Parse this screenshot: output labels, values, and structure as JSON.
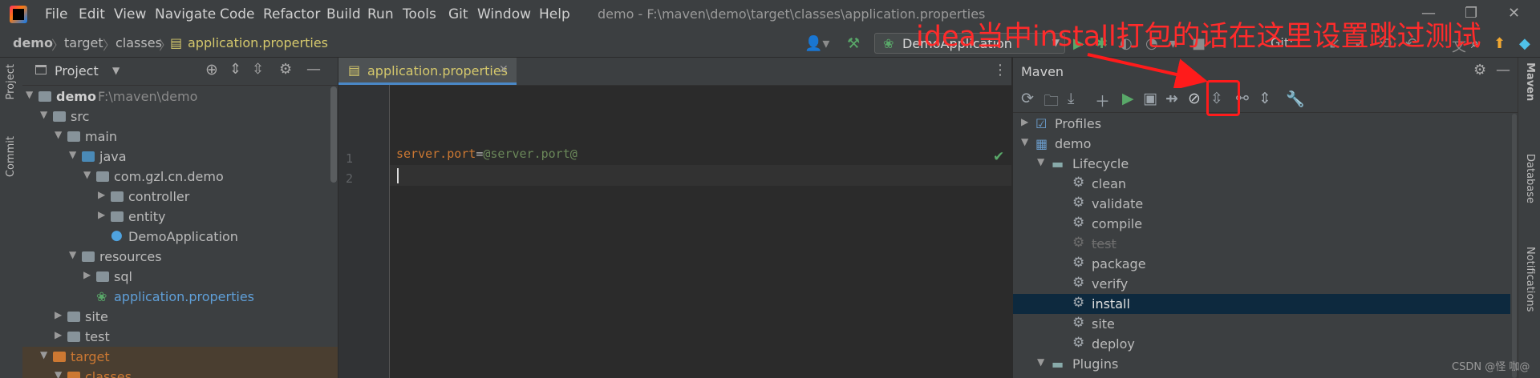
{
  "app": {
    "window_title": "demo - F:\\maven\\demo\\target\\classes\\application.properties",
    "menu": [
      "File",
      "Edit",
      "View",
      "Navigate",
      "Code",
      "Refactor",
      "Build",
      "Run",
      "Tools",
      "Git",
      "Window",
      "Help"
    ]
  },
  "breadcrumbs": [
    "demo",
    "target",
    "classes",
    "application.properties"
  ],
  "toolbar": {
    "run_config": "DemoApplication",
    "git_label": "Git:"
  },
  "left_strip": {
    "project": "Project",
    "commit": "Commit"
  },
  "right_strip": {
    "maven": "Maven",
    "database": "Database",
    "notifications": "Notifications"
  },
  "project_panel": {
    "title": "Project",
    "tree": [
      {
        "label": "demo",
        "path": "F:\\maven\\demo"
      },
      {
        "label": "src"
      },
      {
        "label": "main"
      },
      {
        "label": "java"
      },
      {
        "label": "com.gzl.cn.demo"
      },
      {
        "label": "controller"
      },
      {
        "label": "entity"
      },
      {
        "label": "DemoApplication"
      },
      {
        "label": "resources"
      },
      {
        "label": "sql"
      },
      {
        "label": "application.properties"
      },
      {
        "label": "site"
      },
      {
        "label": "test"
      },
      {
        "label": "target"
      },
      {
        "label": "classes"
      }
    ]
  },
  "editor": {
    "tab_label": "application.properties",
    "lines": [
      {
        "no": "1",
        "key": "server.port",
        "eq": "=",
        "value": "@server.port@"
      },
      {
        "no": "2"
      }
    ]
  },
  "maven": {
    "title": "Maven",
    "profiles": "Profiles",
    "project": "demo",
    "lifecycle": "Lifecycle",
    "phases": [
      "clean",
      "validate",
      "compile",
      "test",
      "package",
      "verify",
      "install",
      "site",
      "deploy"
    ],
    "plugins": "Plugins"
  },
  "annotation": "idea当中install打包的话在这里设置跳过测试",
  "watermark": "CSDN @怪 咖@",
  "colors": {
    "annotation": "#ff2b2b",
    "accent": "#4a88c7",
    "selected_row": "#0d293e"
  }
}
